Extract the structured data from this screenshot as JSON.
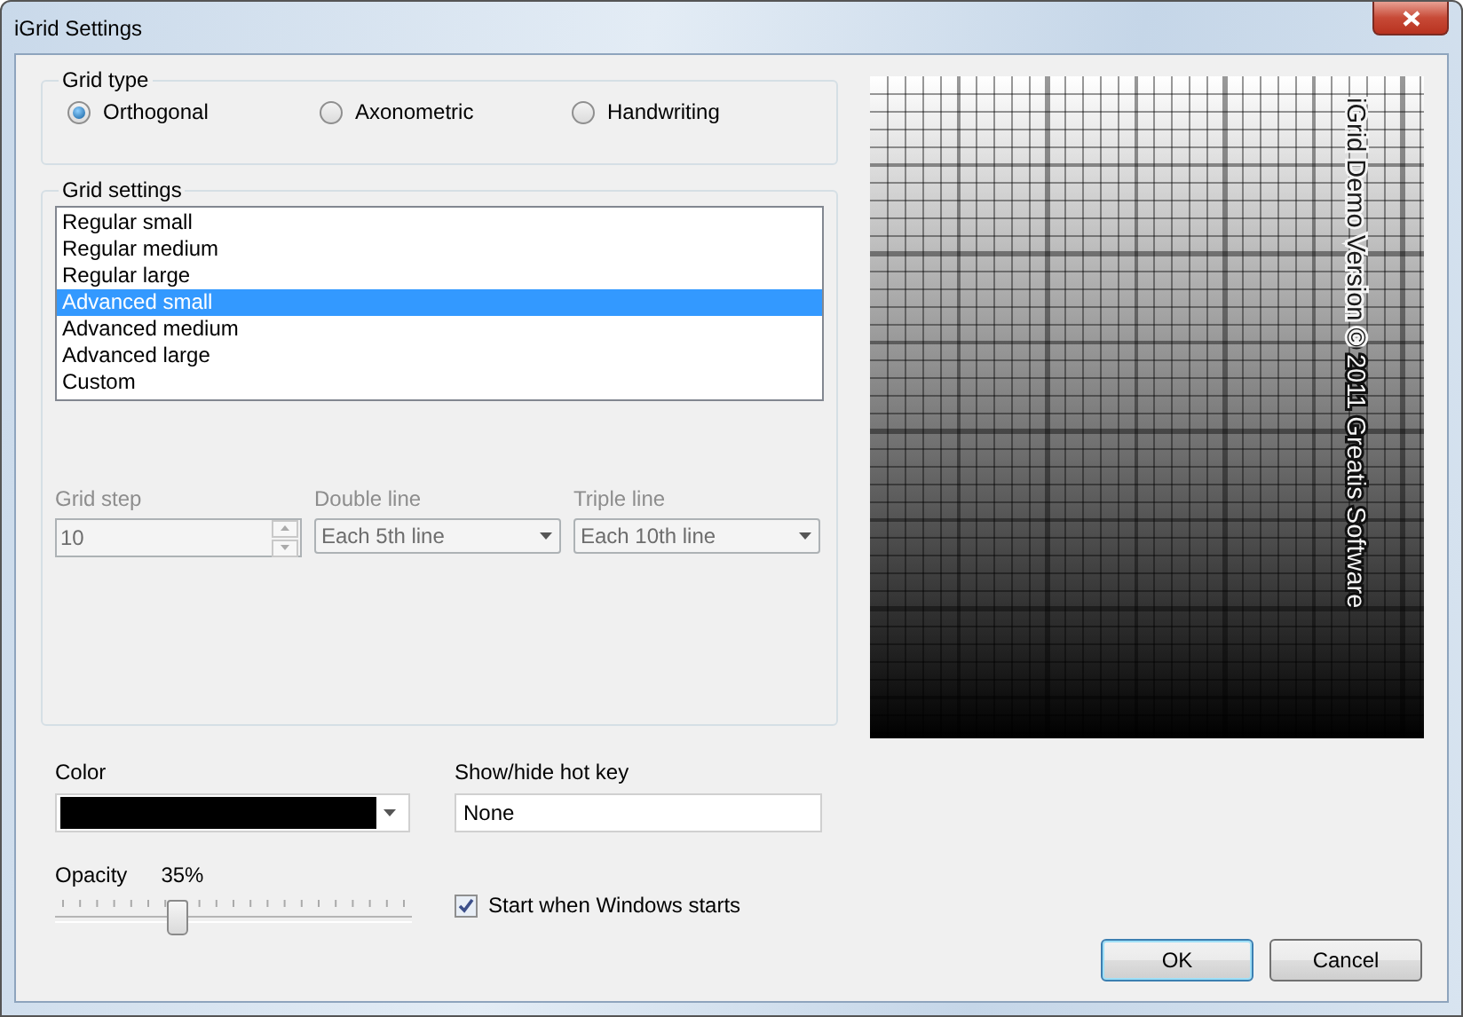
{
  "window": {
    "title": "iGrid Settings"
  },
  "grid_type": {
    "label": "Grid type",
    "options": [
      {
        "label": "Orthogonal",
        "selected": true
      },
      {
        "label": "Axonometric",
        "selected": false
      },
      {
        "label": "Handwriting",
        "selected": false
      }
    ]
  },
  "grid_settings": {
    "label": "Grid settings",
    "presets": [
      {
        "label": "Regular small",
        "selected": false
      },
      {
        "label": "Regular medium",
        "selected": false
      },
      {
        "label": "Regular large",
        "selected": false
      },
      {
        "label": "Advanced small",
        "selected": true
      },
      {
        "label": "Advanced medium",
        "selected": false
      },
      {
        "label": "Advanced large",
        "selected": false
      },
      {
        "label": "Custom",
        "selected": false
      }
    ],
    "grid_step": {
      "label": "Grid step",
      "value": "10",
      "disabled": true
    },
    "double_line": {
      "label": "Double line",
      "value": "Each 5th line",
      "disabled": true
    },
    "triple_line": {
      "label": "Triple line",
      "value": "Each 10th line",
      "disabled": true
    }
  },
  "color": {
    "label": "Color"
  },
  "hot_key": {
    "label": "Show/hide hot key",
    "value": "None"
  },
  "opacity": {
    "label": "Opacity",
    "reading": "35%",
    "level": 0.33
  },
  "start_with_windows": {
    "label": "Start when Windows starts",
    "checked": true
  },
  "preview": {
    "text": "iGrid Demo Version © 2011 Greatis Software"
  },
  "buttons": [
    {
      "label": "OK",
      "default": true
    },
    {
      "label": "Cancel",
      "default": false
    }
  ]
}
